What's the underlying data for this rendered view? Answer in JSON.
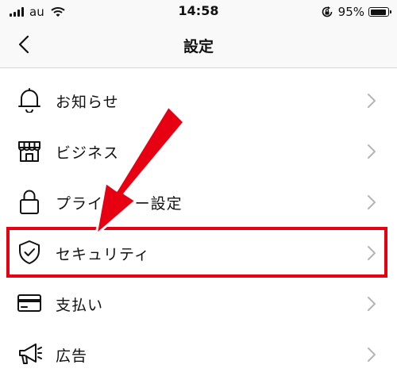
{
  "status_bar": {
    "carrier": "au",
    "time": "14:58",
    "battery_percent": "95%",
    "battery_level": 0.95,
    "icons": [
      "signal-bars-icon",
      "wifi-icon",
      "rotation-lock-icon",
      "battery-icon"
    ]
  },
  "header": {
    "title": "設定",
    "back_icon": "chevron-left-icon"
  },
  "settings": {
    "items": [
      {
        "label": "お知らせ",
        "icon": "bell-icon"
      },
      {
        "label": "ビジネス",
        "icon": "shop-icon"
      },
      {
        "label": "プライバシー設定",
        "icon": "lock-icon"
      },
      {
        "label": "セキュリティ",
        "icon": "shield-check-icon",
        "highlighted": true
      },
      {
        "label": "支払い",
        "icon": "credit-card-icon"
      },
      {
        "label": "広告",
        "icon": "megaphone-icon"
      }
    ]
  },
  "annotation": {
    "highlight_color": "#e60012",
    "arrow_color": "#e60012"
  }
}
